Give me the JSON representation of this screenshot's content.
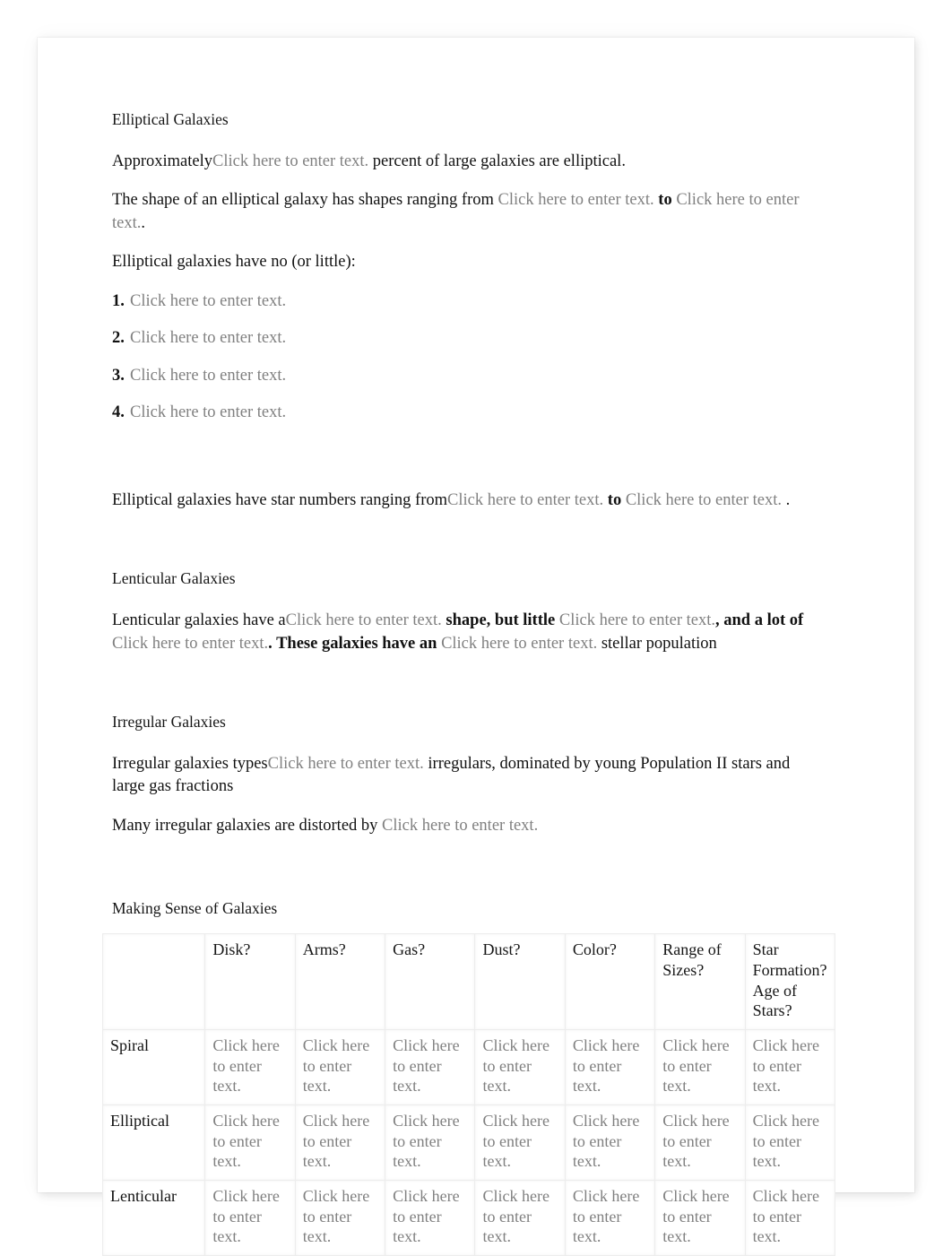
{
  "document": {
    "placeholder_text": "Click here to enter text.",
    "placeholder_color": "#808080",
    "body_color": "#111111",
    "sections": {
      "elliptical": {
        "heading": "Elliptical Galaxies",
        "para_percent": {
          "lead": "Approximately",
          "placeholder": "Click here to enter text.",
          "tail": " percent of large galaxies are elliptical."
        },
        "para_shape": {
          "lead": "The shape of an elliptical galaxy has shapes ranging from ",
          "placeholder1": "Click here to enter text.",
          "middle": " to ",
          "placeholder2": "Click here to enter text.",
          "tail": "."
        },
        "list_intro": "Elliptical galaxies have no (or little):",
        "list": [
          {
            "num": "1.",
            "text": "Click here to enter text."
          },
          {
            "num": "2.",
            "text": "Click here to enter text."
          },
          {
            "num": "3.",
            "text": "Click here to enter text."
          },
          {
            "num": "4.",
            "text": "Click here to enter text."
          }
        ],
        "para_stars": {
          "lead": "Elliptical galaxies have star numbers ranging from",
          "placeholder1": "Click here to enter text.",
          "middle": " to ",
          "placeholder2": "Click here to enter text.",
          "tail": " ."
        }
      },
      "lenticular": {
        "heading": "Lenticular Galaxies",
        "para": {
          "lead": "Lenticular galaxies have a",
          "placeholder1": "Click here to enter text.",
          "mid1": " shape, but little ",
          "placeholder2": "Click here to enter text.",
          "mid2": ", and a lot of ",
          "placeholder3": "Click here to enter text.",
          "mid3": ".  These galaxies have an ",
          "placeholder4": "Click here to enter text.",
          "tail": " stellar population"
        }
      },
      "irregular": {
        "heading": "Irregular Galaxies",
        "para_types": {
          "lead": "Irregular galaxies types",
          "placeholder": "Click here to enter text.",
          "tail": "  irregulars, dominated by young Population II stars and large gas fractions"
        },
        "para_distorted": {
          "lead": "Many irregular galaxies are distorted by ",
          "placeholder": "Click here to enter text."
        }
      },
      "making_sense": {
        "heading": "Making Sense of Galaxies"
      }
    }
  },
  "table": {
    "columns": [
      "",
      "Disk?",
      "Arms?",
      "Gas?",
      "Dust?",
      "Color?",
      "Range of Sizes?",
      "Star Formation? Age of Stars?"
    ],
    "rows": [
      {
        "label": "Spiral",
        "cells": [
          "Click here to enter text.",
          "Click here to enter text.",
          "Click here to enter text.",
          "Click here to enter text.",
          "Click here to enter text.",
          "Click here to enter text.",
          "Click here to enter text."
        ]
      },
      {
        "label": "Elliptical",
        "cells": [
          "Click here to enter text.",
          "Click here to enter text.",
          "Click here to enter text.",
          "Click here to enter text.",
          "Click here to enter text.",
          "Click here to enter text.",
          "Click here to enter text."
        ]
      },
      {
        "label": "Lenticular",
        "cells": [
          "Click here to enter text.",
          "Click here to enter text.",
          "Click here to enter text.",
          "Click here to enter text.",
          "Click here to enter text.",
          "Click here to enter text.",
          "Click here to enter text."
        ]
      }
    ]
  }
}
